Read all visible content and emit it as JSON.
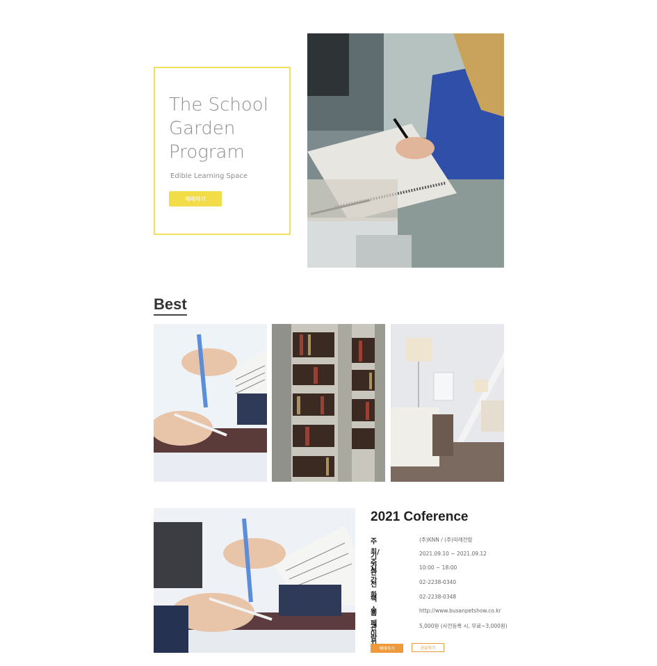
{
  "hero": {
    "title": "The School Garden Program",
    "subtitle": "Edible Learning Space",
    "button_label": "예매하기"
  },
  "best": {
    "heading": "Best",
    "tiles": [
      "signing-documents-photo",
      "library-bookshelf-photo",
      "living-room-photo"
    ]
  },
  "conference": {
    "title": "2021 Coference",
    "rows": [
      {
        "label": "주최/주관",
        "value": "(주)KNN / (주)미래전람"
      },
      {
        "label": "기간",
        "value": "2021.09.10 ~ 2021.09.12"
      },
      {
        "label": "시간",
        "value": "10:00 ~ 18:00"
      },
      {
        "label": "전화",
        "value": "02-2238-0340"
      },
      {
        "label": "팩스",
        "value": "02-2238-0348"
      },
      {
        "label": "홈페이지",
        "value": "http://www.busanpetshow.co.kr"
      },
      {
        "label": "관람료",
        "value": "5,000원 (사전등록 시, 무료~3,000원)"
      }
    ],
    "buttons": {
      "primary": "예매하기",
      "secondary": "공유하기"
    }
  },
  "colors": {
    "accent_yellow": "#f2dc48",
    "accent_orange": "#ef9a3a",
    "text_dark": "#222222",
    "text_grey": "#8d8d8d"
  }
}
